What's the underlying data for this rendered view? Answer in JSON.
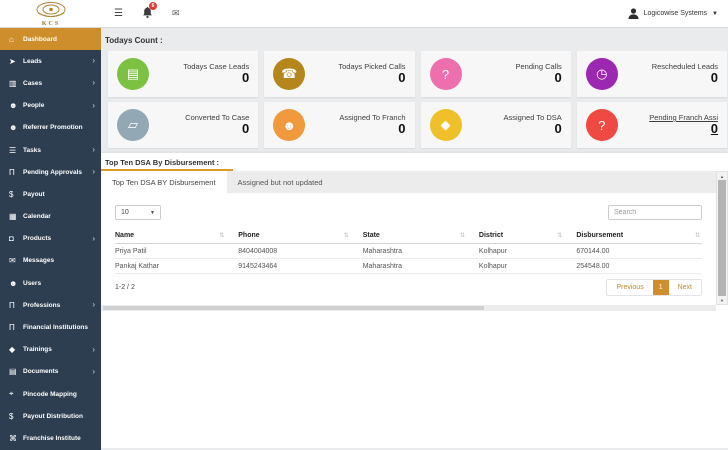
{
  "topbar": {
    "brand": "KCS",
    "menu_icon": "hamburger",
    "notification_count": "6",
    "user_name": "Logicowise Systems"
  },
  "sidebar": {
    "items": [
      {
        "label": "Dashboard",
        "icon": "home-icon",
        "glyph": "⌂",
        "active": true,
        "chevron": false
      },
      {
        "label": "Leads",
        "icon": "send-icon",
        "glyph": "➤",
        "active": false,
        "chevron": true
      },
      {
        "label": "Cases",
        "icon": "briefcase-icon",
        "glyph": "▥",
        "active": false,
        "chevron": true
      },
      {
        "label": "People",
        "icon": "users-icon",
        "glyph": "☻",
        "active": false,
        "chevron": true
      },
      {
        "label": "Referrer Promotion",
        "icon": "users-icon",
        "glyph": "☻",
        "active": false,
        "chevron": false
      },
      {
        "label": "Tasks",
        "icon": "list-icon",
        "glyph": "☰",
        "active": false,
        "chevron": true
      },
      {
        "label": "Pending Approvals",
        "icon": "bank-icon",
        "glyph": "Π",
        "active": false,
        "chevron": true
      },
      {
        "label": "Payout",
        "icon": "money-icon",
        "glyph": "$",
        "active": false,
        "chevron": false
      },
      {
        "label": "Calendar",
        "icon": "calendar-icon",
        "glyph": "▦",
        "active": false,
        "chevron": false
      },
      {
        "label": "Products",
        "icon": "product-icon",
        "glyph": "◘",
        "active": false,
        "chevron": true
      },
      {
        "label": "Messages",
        "icon": "envelope-icon",
        "glyph": "✉",
        "active": false,
        "chevron": false
      },
      {
        "label": "Users",
        "icon": "users-icon",
        "glyph": "☻",
        "active": false,
        "chevron": false
      },
      {
        "label": "Professions",
        "icon": "bank-icon",
        "glyph": "Π",
        "active": false,
        "chevron": true
      },
      {
        "label": "Financial Institutions",
        "icon": "bank-icon",
        "glyph": "Π",
        "active": false,
        "chevron": false
      },
      {
        "label": "Trainings",
        "icon": "graduation-cap-icon",
        "glyph": "◆",
        "active": false,
        "chevron": true
      },
      {
        "label": "Documents",
        "icon": "file-icon",
        "glyph": "▤",
        "active": false,
        "chevron": true
      },
      {
        "label": "Pincode Mapping",
        "icon": "map-pin-icon",
        "glyph": "⌖",
        "active": false,
        "chevron": false
      },
      {
        "label": "Payout Distribution",
        "icon": "money-icon",
        "glyph": "$",
        "active": false,
        "chevron": false
      },
      {
        "label": "Franchise Institute",
        "icon": "key-icon",
        "glyph": "⌘",
        "active": false,
        "chevron": false
      }
    ]
  },
  "counts": {
    "title": "Todays Count :",
    "cards": [
      {
        "label": "Todays Case Leads",
        "value": "0",
        "color": "#7cc142",
        "icon": "file-icon",
        "glyph": "▤",
        "underline": false
      },
      {
        "label": "Todays Picked Calls",
        "value": "0",
        "color": "#b5861b",
        "icon": "phone-icon",
        "glyph": "☎",
        "underline": false
      },
      {
        "label": "Pending Calls",
        "value": "0",
        "color": "#ee6fae",
        "icon": "question-icon",
        "glyph": "?",
        "underline": false
      },
      {
        "label": "Rescheduled Leads",
        "value": "0",
        "color": "#9c27b0",
        "icon": "clock-icon",
        "glyph": "◷",
        "underline": false
      },
      {
        "label": "Converted To Case",
        "value": "0",
        "color": "#92a8b5",
        "icon": "folder-icon",
        "glyph": "▱",
        "underline": false
      },
      {
        "label": "Assigned To Franch",
        "value": "0",
        "color": "#f0993d",
        "icon": "person-icon",
        "glyph": "☻",
        "underline": false
      },
      {
        "label": "Assigned To DSA",
        "value": "0",
        "color": "#f0c02a",
        "icon": "graduation-cap-icon",
        "glyph": "◆",
        "underline": false
      },
      {
        "label": "Pending Franch Assi",
        "value": "0",
        "color": "#ef4a41",
        "icon": "question-icon",
        "glyph": "?",
        "underline": true
      }
    ]
  },
  "section": {
    "title": "Top Ten DSA By Disbursement :",
    "tabs": [
      {
        "label": "Top Ten DSA BY Disbursement",
        "active": true
      },
      {
        "label": "Assigned but not updated",
        "active": false
      }
    ],
    "page_size": "10",
    "search_placeholder": "Search",
    "table": {
      "sort_icon": "⇅",
      "columns": [
        "Name",
        "Phone",
        "State",
        "District",
        "Disbursement"
      ],
      "col_widths": [
        "21%",
        "21.2%",
        "19.8%",
        "16.6%",
        "21.4%"
      ],
      "rows": [
        [
          "Priya Patil",
          "8404004008",
          "Maharashtra",
          "Kolhapur",
          "670144.00"
        ],
        [
          "Pankaj Kathar",
          "9145243464",
          "Maharashtra",
          "Kolhapur",
          "254548.00"
        ]
      ]
    },
    "pagination": {
      "info": "1-2 / 2",
      "previous": "Previous",
      "page": "1",
      "next": "Next"
    }
  },
  "colors": {
    "accent_gold": "#ce8e2b",
    "sidebar_bg": "#2d3e50",
    "badge_red": "#e23c33",
    "tab_underline": "#d9992b"
  }
}
